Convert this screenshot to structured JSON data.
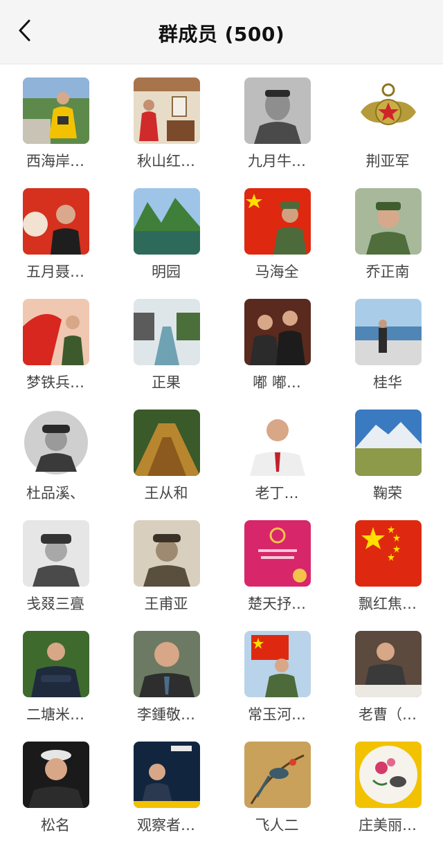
{
  "header": {
    "title": "群成员 (500)"
  },
  "members": [
    {
      "name": "西海岸…",
      "avatar": "photo-man-yellow-jacket-icon"
    },
    {
      "name": "秋山红…",
      "avatar": "photo-woman-red-room-icon"
    },
    {
      "name": "九月牛…",
      "avatar": "photo-bw-soldier-portrait-icon"
    },
    {
      "name": "荆亚军",
      "avatar": "army-emblem-icon"
    },
    {
      "name": "五月聂…",
      "avatar": "photo-woman-red-decor-icon"
    },
    {
      "name": "明园",
      "avatar": "photo-landscape-lake-icon"
    },
    {
      "name": "马海全",
      "avatar": "photo-soldier-flag-icon"
    },
    {
      "name": "乔正南",
      "avatar": "photo-soldier-green-icon"
    },
    {
      "name": "梦铁兵…",
      "avatar": "photo-soldier-poster-icon"
    },
    {
      "name": "正果",
      "avatar": "photo-canal-town-icon"
    },
    {
      "name": "嘟 嘟…",
      "avatar": "photo-two-men-icon"
    },
    {
      "name": "桂华",
      "avatar": "photo-man-seaside-icon"
    },
    {
      "name": "杜品溪、",
      "avatar": "photo-bw-soldier-round-icon"
    },
    {
      "name": "王从和",
      "avatar": "photo-autumn-road-icon"
    },
    {
      "name": "老丁…",
      "avatar": "photo-man-red-tie-icon"
    },
    {
      "name": "鞠荣",
      "avatar": "photo-mountain-lake-icon"
    },
    {
      "name": "戋叕三亹",
      "avatar": "photo-bw-soldier-cap-icon"
    },
    {
      "name": "王甫亚",
      "avatar": "photo-sepia-soldier-icon"
    },
    {
      "name": "楚天抒…",
      "avatar": "party-book-cover-icon"
    },
    {
      "name": "飘红焦…",
      "avatar": "china-flag-icon"
    },
    {
      "name": "二塘米…",
      "avatar": "photo-man-arms-crossed-icon"
    },
    {
      "name": "李鍾敬…",
      "avatar": "photo-old-man-suit-icon"
    },
    {
      "name": "常玉河…",
      "avatar": "photo-soldier-red-flag-icon"
    },
    {
      "name": "老曹（…",
      "avatar": "photo-man-dinner-icon"
    },
    {
      "name": "松名",
      "avatar": "photo-man-white-hat-icon"
    },
    {
      "name": "观察者…",
      "avatar": "photo-poster-man-icon"
    },
    {
      "name": "飞人二",
      "avatar": "painting-bird-icon"
    },
    {
      "name": "庄美丽…",
      "avatar": "painting-flowers-icon"
    }
  ],
  "colors": {
    "navbar_bg": "#f5f5f5",
    "title": "#111111",
    "name_text": "#444444",
    "flag_red": "#de2910",
    "flag_star": "#ffde00"
  }
}
